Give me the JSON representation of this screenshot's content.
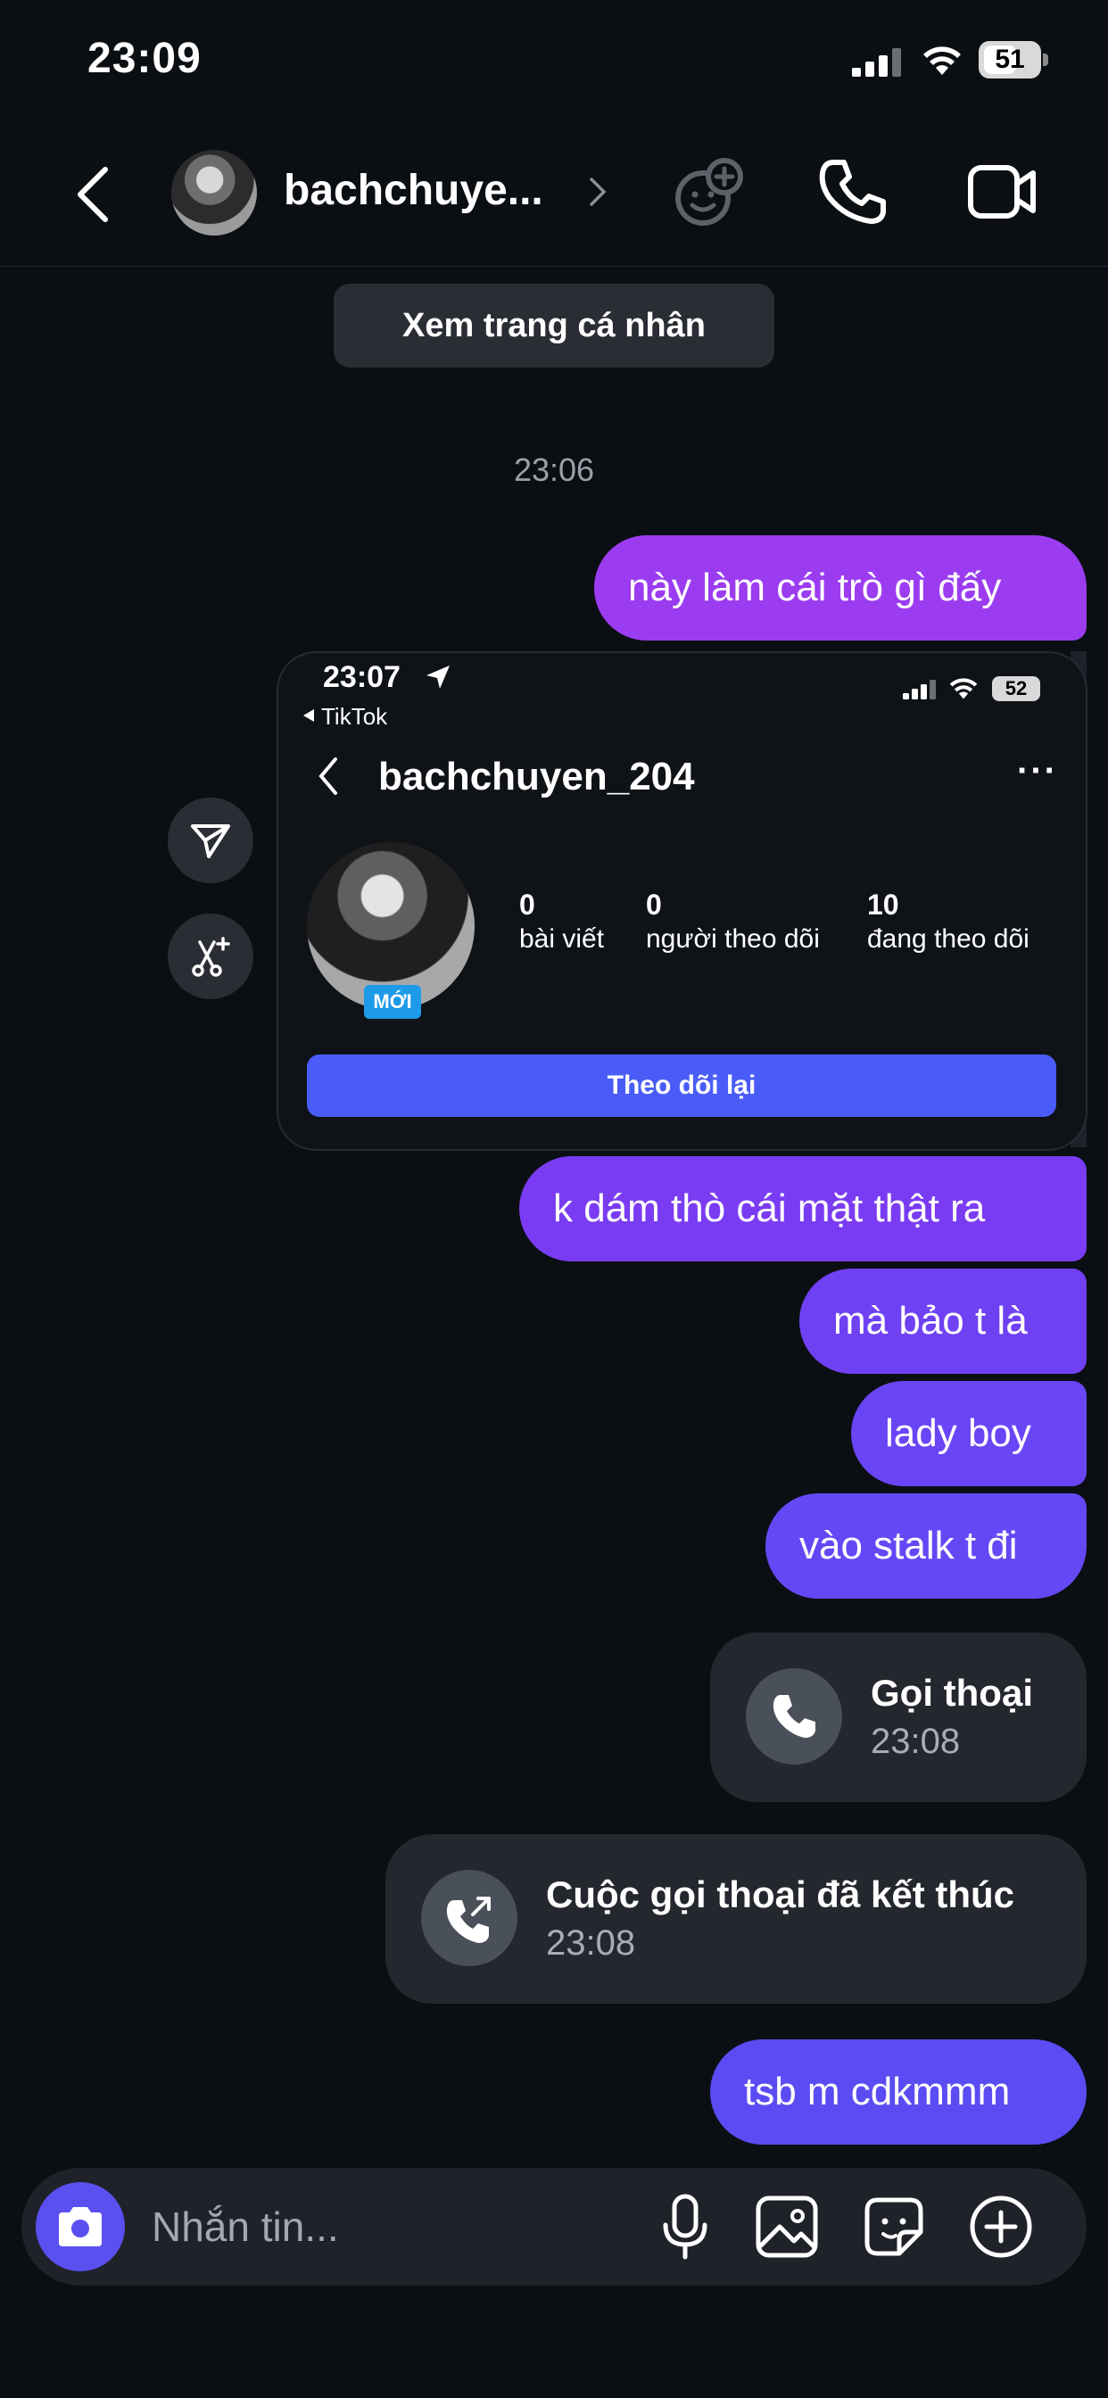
{
  "status_bar": {
    "time": "23:09",
    "battery": "51"
  },
  "header": {
    "contact_name": "bachchuye..."
  },
  "profile_button": "Xem trang cá nhân",
  "timestamp": "23:06",
  "messages": [
    "này làm cái trò gì đấy",
    "k dám thò cái mặt thật ra",
    "mà bảo t là",
    "lady boy",
    "vào stalk t đi",
    "tsb m cdkmmm"
  ],
  "shared_screenshot": {
    "time": "23:07",
    "back_app": "TikTok",
    "battery": "52",
    "username": "bachchuyen_204",
    "badge": "MỚI",
    "stats": [
      {
        "value": "0",
        "label": "bài viết"
      },
      {
        "value": "0",
        "label": "người theo dõi"
      },
      {
        "value": "10",
        "label": "đang theo dõi"
      }
    ],
    "follow_back": "Theo dõi lại"
  },
  "calls": [
    {
      "title": "Gọi thoại",
      "time": "23:08"
    },
    {
      "title": "Cuộc gọi thoại đã kết thúc",
      "time": "23:08"
    }
  ],
  "composer": {
    "placeholder": "Nhắn tin..."
  },
  "colors": {
    "bubble_magenta": "#9b3cf0",
    "bubble_purple": "#6a45f5",
    "bubble_indigo": "#5a4cf2",
    "follow_button": "#4a5cf7",
    "camera_button": "#5a50f0"
  }
}
